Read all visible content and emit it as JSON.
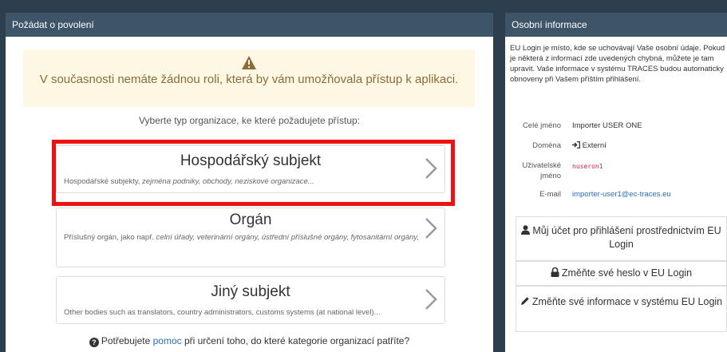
{
  "left_panel": {
    "title": "Požádat o povolení",
    "warning": {
      "icon": "warning-icon",
      "text": "V současnosti nemáte žádnou roli, která by vám umožňovala přístup k aplikaci."
    },
    "select_label": "Vyberte typ organizace, ke které požadujete přístup:",
    "org_types": [
      {
        "title": "Hospodářský subjekt",
        "desc_plain": "Hospodářské subjekty, ",
        "desc_italic": "zejména podniky, obchody, neziskové organizace...",
        "highlighted": true
      },
      {
        "title": "Orgán",
        "desc_plain": "Příslušný orgán, jako např. ",
        "desc_italic": "celní úřady, veterinární orgány, ústřední příslušné orgány, fytosanitární orgány,"
      },
      {
        "title": "Jiný subjekt",
        "desc_plain": "Other bodies such as translators, country administrators, customs systems (at national level)...",
        "desc_italic": ""
      }
    ],
    "help": {
      "before": "Potřebujete ",
      "link": "pomoc",
      "after": " při určení toho, do které kategorie organizací patříte?"
    },
    "highlight_color": "#ee1111"
  },
  "right_panel": {
    "title": "Osobní informace",
    "intro": "EU Login je místo, kde se uchovávají Vaše osobní údaje. Pokud je některá z informací zde uvedených chybná, můžete je tam upravit. Vaše informace v systému TRACES budou automaticky obnoveny při Vašem příštím přihlášení.",
    "fields": {
      "full_name_label": "Celé jméno",
      "full_name": "Importer USER ONE",
      "domain_label": "Doména",
      "domain": "Externí",
      "username_label_1": "Uživatelské",
      "username_label_2": "jméno",
      "username": "nuseron1",
      "email_label": "E-mail",
      "email": "importer-user1@ec-traces.eu"
    },
    "buttons": {
      "account": "Můj účet pro přihlášení prostřednictvím EU Login",
      "password": "Změňte své heslo v EU Login",
      "info": "Změňte své informace v systému EU Login"
    }
  },
  "colors": {
    "header_bg": "#3e5468",
    "page_bg": "#2d3e4f",
    "warning_bg": "#fcf8e3",
    "warning_text": "#8a6d3b",
    "link": "#2a6fb5"
  }
}
